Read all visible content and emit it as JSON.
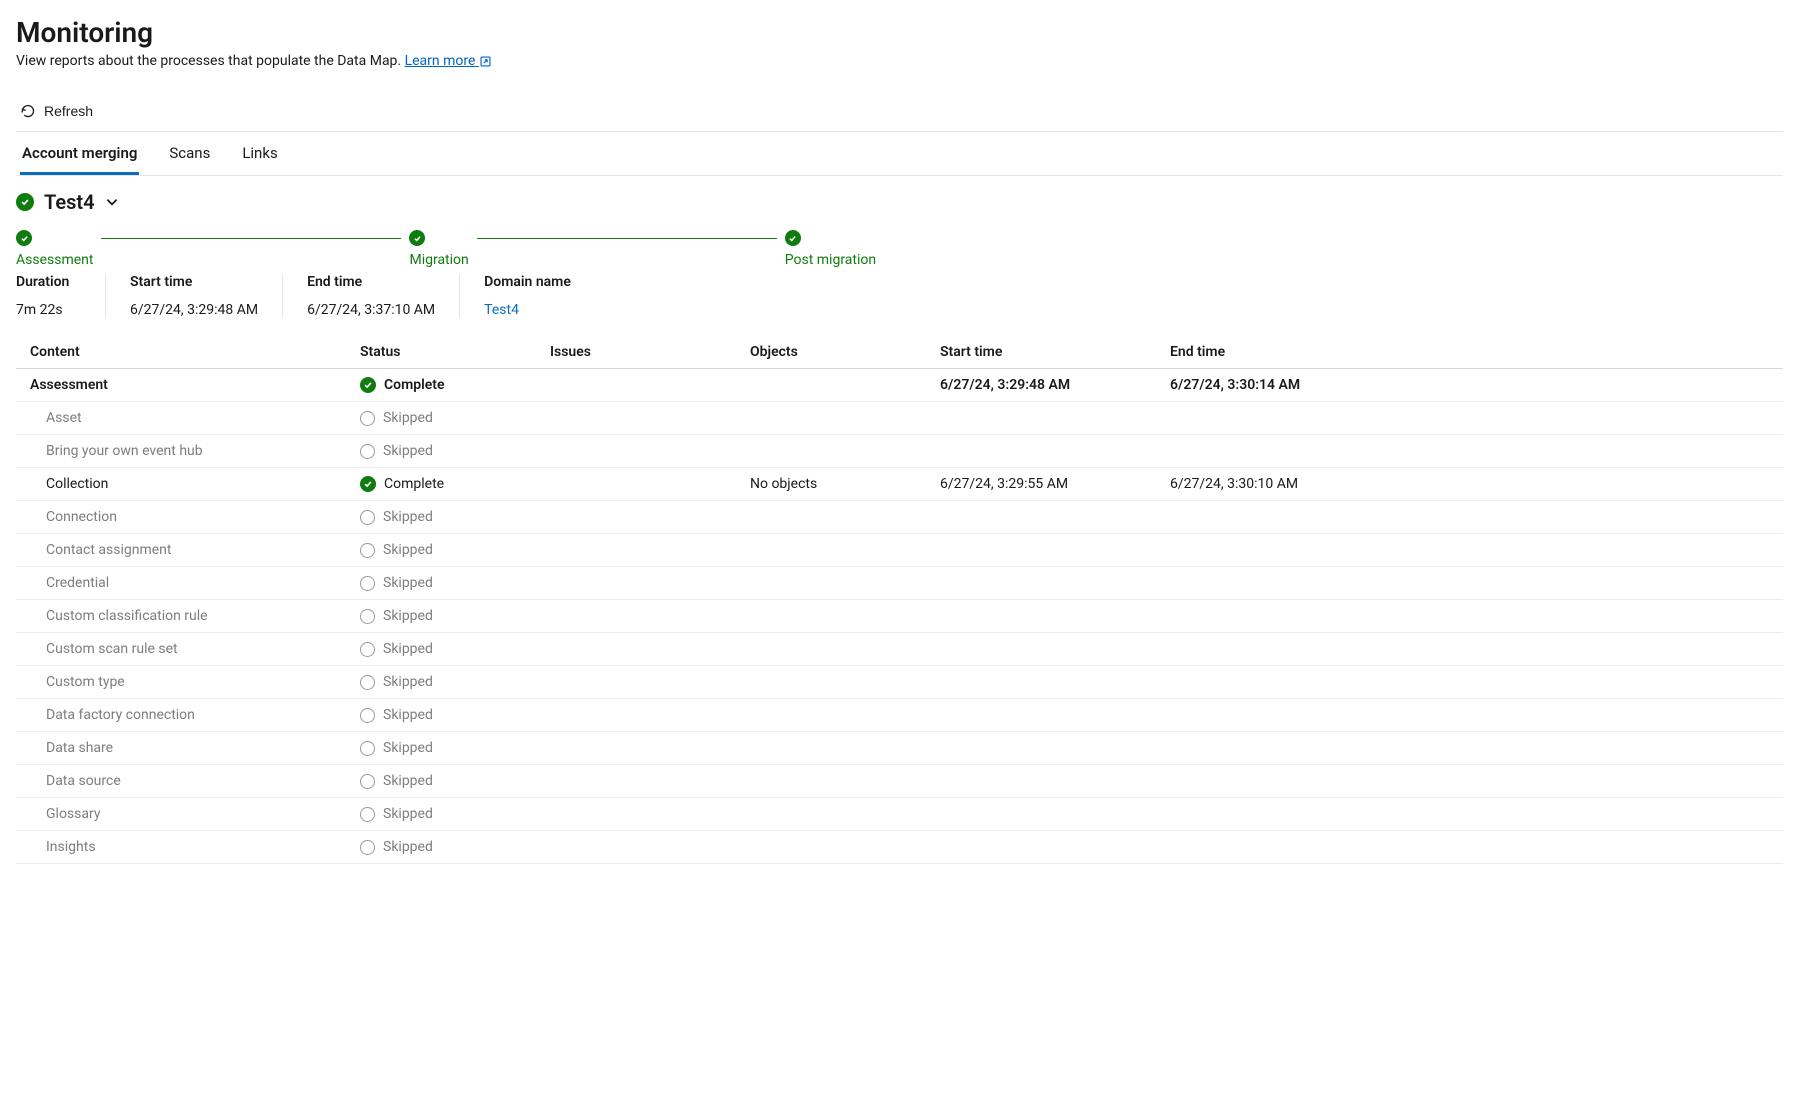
{
  "header": {
    "title": "Monitoring",
    "subtitle_prefix": "View reports about the processes that populate the Data Map. ",
    "learn_more": "Learn more"
  },
  "toolbar": {
    "refresh_label": "Refresh"
  },
  "tabs": [
    {
      "label": "Account merging",
      "active": true
    },
    {
      "label": "Scans",
      "active": false
    },
    {
      "label": "Links",
      "active": false
    }
  ],
  "selector": {
    "name": "Test4"
  },
  "phases": [
    {
      "label": "Assessment"
    },
    {
      "label": "Migration"
    },
    {
      "label": "Post migration"
    }
  ],
  "summary": {
    "duration_label": "Duration",
    "duration_value": "7m 22s",
    "start_label": "Start time",
    "start_value": "6/27/24, 3:29:48 AM",
    "end_label": "End time",
    "end_value": "6/27/24, 3:37:10 AM",
    "domain_label": "Domain name",
    "domain_value": "Test4"
  },
  "grid": {
    "headers": {
      "content": "Content",
      "status": "Status",
      "issues": "Issues",
      "objects": "Objects",
      "start": "Start time",
      "end": "End time"
    },
    "rows": [
      {
        "content": "Assessment",
        "status": "Complete",
        "status_kind": "complete",
        "issues": "",
        "objects": "",
        "start": "6/27/24, 3:29:48 AM",
        "end": "6/27/24, 3:30:14 AM",
        "level": 0
      },
      {
        "content": "Asset",
        "status": "Skipped",
        "status_kind": "skipped",
        "issues": "",
        "objects": "",
        "start": "",
        "end": "",
        "level": 1
      },
      {
        "content": "Bring your own event hub",
        "status": "Skipped",
        "status_kind": "skipped",
        "issues": "",
        "objects": "",
        "start": "",
        "end": "",
        "level": 1
      },
      {
        "content": "Collection",
        "status": "Complete",
        "status_kind": "complete",
        "issues": "",
        "objects": "No objects",
        "start": "6/27/24, 3:29:55 AM",
        "end": "6/27/24, 3:30:10 AM",
        "level": 1,
        "strong": true
      },
      {
        "content": "Connection",
        "status": "Skipped",
        "status_kind": "skipped",
        "issues": "",
        "objects": "",
        "start": "",
        "end": "",
        "level": 1
      },
      {
        "content": "Contact assignment",
        "status": "Skipped",
        "status_kind": "skipped",
        "issues": "",
        "objects": "",
        "start": "",
        "end": "",
        "level": 1
      },
      {
        "content": "Credential",
        "status": "Skipped",
        "status_kind": "skipped",
        "issues": "",
        "objects": "",
        "start": "",
        "end": "",
        "level": 1
      },
      {
        "content": "Custom classification rule",
        "status": "Skipped",
        "status_kind": "skipped",
        "issues": "",
        "objects": "",
        "start": "",
        "end": "",
        "level": 1
      },
      {
        "content": "Custom scan rule set",
        "status": "Skipped",
        "status_kind": "skipped",
        "issues": "",
        "objects": "",
        "start": "",
        "end": "",
        "level": 1
      },
      {
        "content": "Custom type",
        "status": "Skipped",
        "status_kind": "skipped",
        "issues": "",
        "objects": "",
        "start": "",
        "end": "",
        "level": 1
      },
      {
        "content": "Data factory connection",
        "status": "Skipped",
        "status_kind": "skipped",
        "issues": "",
        "objects": "",
        "start": "",
        "end": "",
        "level": 1
      },
      {
        "content": "Data share",
        "status": "Skipped",
        "status_kind": "skipped",
        "issues": "",
        "objects": "",
        "start": "",
        "end": "",
        "level": 1
      },
      {
        "content": "Data source",
        "status": "Skipped",
        "status_kind": "skipped",
        "issues": "",
        "objects": "",
        "start": "",
        "end": "",
        "level": 1
      },
      {
        "content": "Glossary",
        "status": "Skipped",
        "status_kind": "skipped",
        "issues": "",
        "objects": "",
        "start": "",
        "end": "",
        "level": 1
      },
      {
        "content": "Insights",
        "status": "Skipped",
        "status_kind": "skipped",
        "issues": "",
        "objects": "",
        "start": "",
        "end": "",
        "level": 1
      }
    ]
  }
}
